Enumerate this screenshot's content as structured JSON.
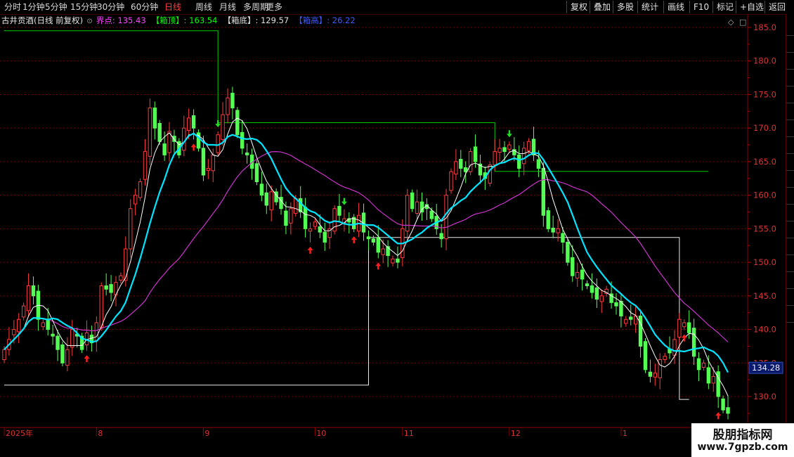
{
  "toolbar": {
    "tabs": [
      "分时",
      "1分钟",
      "5分钟",
      "15分钟",
      "30分钟",
      "60分钟",
      "日线",
      "周线",
      "月线",
      "多周期",
      "更多 "
    ],
    "active_tab": "日线",
    "right_buttons": [
      "复权",
      "叠加",
      "多股",
      "统计",
      "画线",
      "F10",
      "标记",
      "+自选",
      "返回"
    ]
  },
  "legend": {
    "title": "古井贡酒(日线 前复权)",
    "items": [
      {
        "label": "界点: 135.43",
        "color": "#ff40ff"
      },
      {
        "label": "【箱顶】: 163.54",
        "color": "#00ff00"
      },
      {
        "label": "【箱底】: 129.57",
        "color": "#e0e0e0"
      },
      {
        "label": "【箱高】: 26.22",
        "color": "#3b5bff"
      }
    ]
  },
  "watermark": {
    "line1": "股朋指标网",
    "line2": "www.7gpzb.com"
  },
  "chart_data": {
    "type": "candlestick",
    "ylim": [
      125.5,
      186.5
    ],
    "y_ticks": [
      130.0,
      135.0,
      140.0,
      145.0,
      150.0,
      155.0,
      160.0,
      165.0,
      170.0,
      175.0,
      180.0,
      185.0
    ],
    "current_price_label": "134.28",
    "current_price": 134.28,
    "x_labels": [
      {
        "label": "2025年",
        "index": 0
      },
      {
        "label": "8",
        "index": 19
      },
      {
        "label": "9",
        "index": 41
      },
      {
        "label": "10",
        "index": 64
      },
      {
        "label": "11",
        "index": 82
      },
      {
        "label": "12",
        "index": 104
      },
      {
        "label": "1",
        "index": 127
      }
    ],
    "colors": {
      "up": "#ff3b3b",
      "down": "#54ff54",
      "ma5": "#ffffff",
      "ma10": "#00e5ff",
      "ma30": "#cc33cc",
      "box_top": "#00cc00",
      "box_bottom": "#e8e8e8",
      "buy_arrow": "#ff1f1f",
      "sell_arrow": "#22dd22"
    },
    "closes": [
      137.0,
      138.5,
      140.0,
      141.5,
      143.5,
      146.5,
      145.0,
      141.5,
      141.0,
      140.0,
      139.0,
      137.0,
      135.0,
      137.0,
      140.0,
      139.0,
      137.0,
      139.5,
      138.0,
      141.0,
      146.5,
      146.0,
      145.5,
      147.0,
      148.0,
      152.0,
      158.0,
      160.0,
      162.0,
      166.5,
      173.0,
      170.0,
      168.0,
      166.0,
      169.5,
      168.0,
      166.0,
      170.0,
      171.5,
      170.0,
      167.0,
      163.0,
      164.0,
      166.0,
      169.0,
      172.0,
      174.5,
      173.0,
      169.0,
      167.0,
      166.0,
      164.0,
      162.0,
      160.0,
      158.5,
      160.5,
      159.0,
      158.0,
      155.5,
      158.0,
      159.5,
      157.5,
      155.0,
      155.0,
      156.0,
      154.5,
      153.0,
      155.0,
      158.0,
      157.0,
      156.5,
      156.0,
      155.0,
      157.0,
      154.5,
      153.5,
      153.0,
      151.5,
      152.0,
      151.0,
      150.5,
      150.0,
      155.0,
      160.0,
      158.0,
      159.0,
      157.5,
      158.0,
      156.5,
      155.0,
      153.5,
      160.0,
      163.5,
      165.0,
      164.0,
      163.5,
      166.5,
      165.0,
      163.0,
      162.5,
      164.5,
      166.5,
      167.0,
      166.5,
      167.5,
      166.0,
      164.0,
      167.0,
      168.0,
      166.0,
      164.0,
      157.0,
      155.0,
      154.5,
      155.0,
      153.0,
      150.0,
      148.0,
      148.5,
      147.5,
      146.5,
      145.5,
      144.5,
      145.0,
      146.0,
      144.0,
      143.5,
      142.0,
      141.5,
      141.5,
      142.0,
      137.5,
      134.0,
      133.0,
      133.5,
      135.5,
      136.0,
      136.5,
      138.5,
      141.5,
      141.0,
      139.5,
      136.0,
      134.0,
      135.0,
      132.0,
      133.0,
      130.0,
      128.0,
      127.5
    ]
  }
}
